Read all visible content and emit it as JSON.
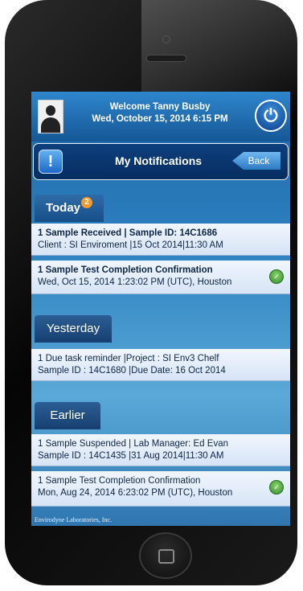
{
  "header": {
    "welcome_line": "Welcome Tanny Busby",
    "date_line": "Wed, October 15, 2014 6:15 PM"
  },
  "title_bar": {
    "title": "My Notifications",
    "back_label": "Back"
  },
  "sections": {
    "today": {
      "label": "Today",
      "badge": "2"
    },
    "yesterday": {
      "label": "Yesterday"
    },
    "earlier": {
      "label": "Earlier"
    }
  },
  "notifications": [
    {
      "line1": "1 Sample Received | Sample ID: 14C1686",
      "line2": "Client : SI Enviroment |15 Oct 2014|11:30 AM"
    },
    {
      "line1": "1 Sample Test Completion Confirmation",
      "line2": "Wed, Oct 15, 2014 1:23:02 PM (UTC), Houston"
    },
    {
      "line1": "1 Due task reminder |Project : SI Env3 Chelf",
      "line2": "Sample ID : 14C1680 |Due Date: 16 Oct 2014"
    },
    {
      "line1": "1 Sample Suspended | Lab Manager: Ed Evan",
      "line2": "Sample ID : 14C1435 |31 Aug 2014|11:30 AM"
    },
    {
      "line1": "1 Sample Test Completion  Confirmation",
      "line2": "Mon, Aug 24, 2014 6:23:02 PM (UTC), Houston"
    }
  ],
  "footer": {
    "text": "Envirodyne Laboratories, Inc."
  },
  "icons": {
    "power": "power-icon",
    "alert": "exclamation-icon",
    "status": "check-circle-icon",
    "avatar": "user-avatar"
  },
  "colors": {
    "brand_blue": "#155796",
    "status_green": "#2e8b2a",
    "badge_orange": "#f29a2e"
  }
}
